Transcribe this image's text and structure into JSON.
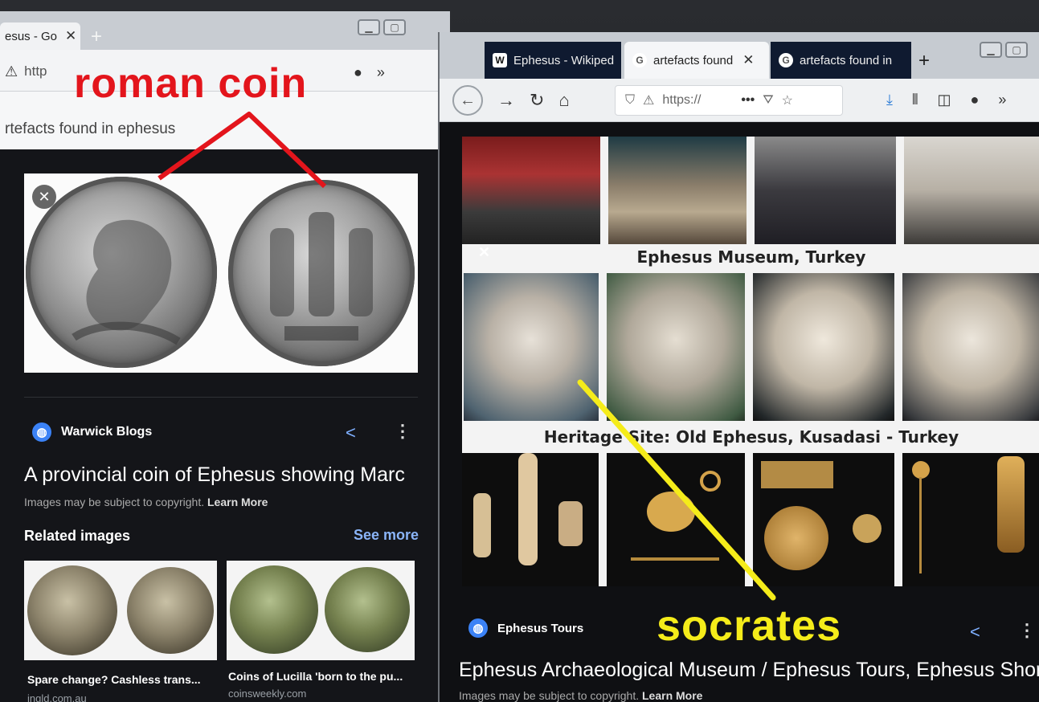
{
  "colors": {
    "annotation_red": "#e3151c",
    "annotation_yellow": "#f5ec1a",
    "link_blue": "#8ab4f8",
    "page_dark": "#141519"
  },
  "left_window": {
    "tab_label": "esus - Go",
    "url_partial": "http",
    "search_query": "rtefacts found in ephesus",
    "result": {
      "source_name": "Warwick Blogs",
      "title": "A provincial coin of Ephesus showing Marc",
      "copyright_note": "Images may be subject to copyright.",
      "learn_more": "Learn More"
    },
    "related": {
      "heading": "Related images",
      "see_more": "See more",
      "items": [
        {
          "caption": "Spare change? Cashless trans...",
          "source": "ingld.com.au"
        },
        {
          "caption": "Coins of Lucilla 'born to the pu...",
          "source": "coinsweekly.com"
        }
      ]
    }
  },
  "right_window": {
    "tabs": [
      {
        "label": "Ephesus - Wikiped",
        "favicon": "W"
      },
      {
        "label": "artefacts found",
        "favicon": "G"
      },
      {
        "label": "artefacts found in",
        "favicon": "G"
      }
    ],
    "url_partial": "https://",
    "collage_captions": [
      "Ephesus Museum, Turkey",
      "Heritage Site: Old Ephesus, Kusadasi - Turkey"
    ],
    "result": {
      "source_name": "Ephesus Tours",
      "title": "Ephesus Archaeological Museum / Ephesus Tours, Ephesus Shor",
      "copyright_note": "Images may be subject to copyright.",
      "learn_more": "Learn More"
    }
  },
  "annotations": {
    "roman_coin": "roman coin",
    "socrates": "socrates"
  },
  "icons": [
    "close-icon",
    "new-tab-icon",
    "lock-warning-icon",
    "back-icon",
    "forward-icon",
    "reload-icon",
    "home-icon",
    "shield-icon",
    "more-icon",
    "pocket-icon",
    "bookmark-star-icon",
    "download-icon",
    "library-icon",
    "sidebar-icon",
    "account-icon",
    "overflow-chevrons-icon",
    "share-icon",
    "globe-icon"
  ]
}
